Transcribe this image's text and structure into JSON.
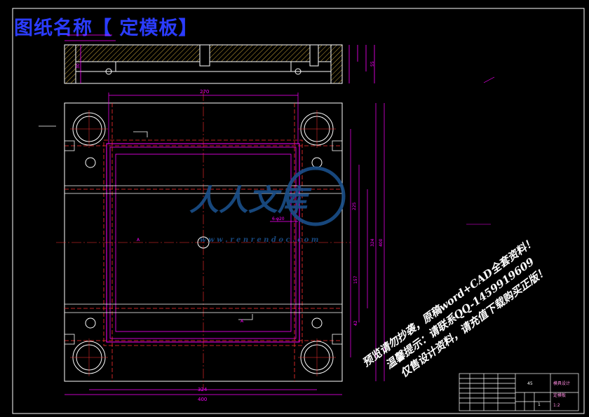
{
  "title": "图纸名称【 定模板】",
  "watermark": {
    "brand": "人人文库",
    "url": "w w w . r e n r e n d o c . c o m",
    "line1": "预览请勿抄袭，原稿word+CAD全套资料！",
    "line2": "温馨提示：请联系QQ-1459919609",
    "line3": "仅售设计资料，请充值下载购买正版！"
  },
  "dimensions": {
    "top_a": "270",
    "left_width": "400",
    "right_total": "400",
    "right_inner": "324",
    "right_mid": "225",
    "right_low": "157",
    "right_small": "42",
    "bottom_inner": "324",
    "bottom_total": "400",
    "hole_note": "6-φ20",
    "section_h": "30",
    "section_top": "55"
  },
  "labels": {
    "section_a": "A",
    "section_a2": "A"
  },
  "title_block": {
    "scale": "45",
    "school": "模具设计",
    "drawing": "定模板",
    "qty": "1",
    "ratio": "1:2"
  },
  "colors": {
    "background": "#000000",
    "outline": "#ffffff",
    "magenta": "#ff00ff",
    "red": "#ff2020",
    "title": "#2b3cff",
    "watermark_blue": "#1a4f8a"
  }
}
